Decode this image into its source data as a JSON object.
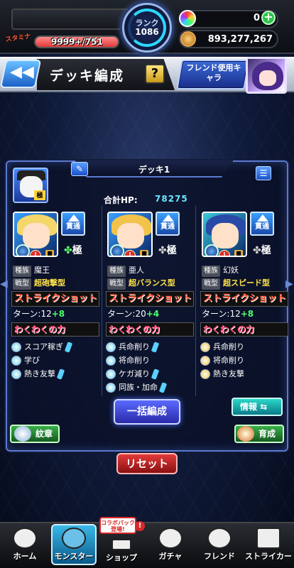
{
  "top": {
    "stamina_label": "スタミナ",
    "stamina_current": "9999+",
    "stamina_max": "/751",
    "rank_label": "ランク",
    "rank_value": "1086",
    "orbs": "0",
    "gold": "893,277,267"
  },
  "header": {
    "title": "デッキ編成",
    "help": "?",
    "friend_button": "フレンド使用キャラ"
  },
  "deck": {
    "name": "デッキ1",
    "hp_label": "合計HP:",
    "hp_value": "78275",
    "friend_badge": "極",
    "monsters": [
      {
        "ability_badge": "貫通",
        "gok_label": "極",
        "race_tag": "種族",
        "race": "魔王",
        "type_tag": "戦型",
        "type": "超砲撃型",
        "strike_shot": "ストライクショット",
        "turn_label": "ターン:12",
        "turn_bonus": "+8",
        "waku": "わくわくの力",
        "items": [
          "スコア稼ぎ",
          "学び",
          "熱き友撃"
        ],
        "hair": "#f4d66a",
        "frame": "#3aa0ff"
      },
      {
        "ability_badge": "貫通",
        "gok_label": "極",
        "race_tag": "種族",
        "race": "亜人",
        "type_tag": "戦型",
        "type": "超バランス型",
        "strike_shot": "ストライクショット",
        "turn_label": "ターン:20",
        "turn_bonus": "+4",
        "waku": "わくわくの力",
        "items": [
          "兵命削り",
          "将命削り",
          "ケガ減り",
          "同族・加命"
        ],
        "hair": "#f2c24a",
        "frame": "#3aa0ff"
      },
      {
        "ability_badge": "貫通",
        "gok_label": "極",
        "race_tag": "種族",
        "race": "幻妖",
        "type_tag": "戦型",
        "type": "超スピード型",
        "strike_shot": "ストライクショット",
        "turn_label": "ターン:12",
        "turn_bonus": "+8",
        "waku": "わくわくの力",
        "items": [
          "兵命削り",
          "将命削り",
          "熱き友撃"
        ],
        "hair": "#2a4aa8",
        "frame": "#3ac8d8"
      }
    ]
  },
  "buttons": {
    "ikkatsu": "一括編成",
    "joho": "情報",
    "kisho": "紋章",
    "ikusei": "育成",
    "reset": "リセット"
  },
  "nav": {
    "items": [
      "ホーム",
      "モンスター",
      "ショップ",
      "ガチャ",
      "フレンド",
      "ストライカー"
    ],
    "collab_badge": "コラボパック登場!"
  }
}
